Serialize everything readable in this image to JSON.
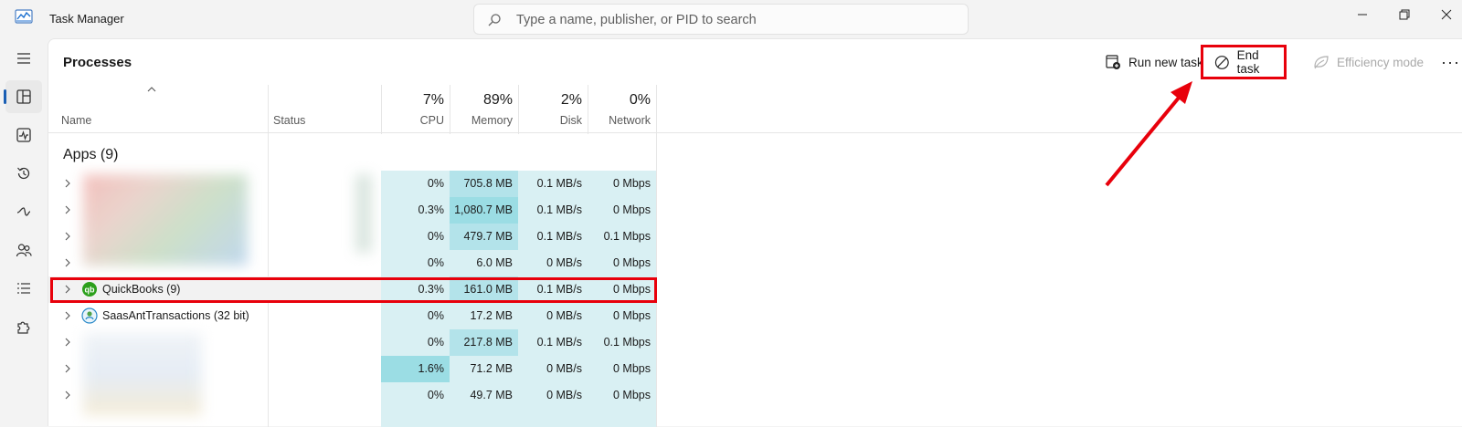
{
  "window": {
    "title": "Task Manager"
  },
  "search": {
    "placeholder": "Type a name, publisher, or PID to search"
  },
  "sidebar": {
    "items": [
      "menu",
      "processes",
      "performance",
      "app-history",
      "startup-apps",
      "users",
      "details",
      "services"
    ],
    "active": "processes"
  },
  "page": {
    "title": "Processes"
  },
  "toolbar": {
    "run_new_task": "Run new task",
    "end_task": "End task",
    "efficiency_mode": "Efficiency mode",
    "more": "···"
  },
  "columns": {
    "name": "Name",
    "status": "Status",
    "cpu": {
      "pct": "7%",
      "label": "CPU"
    },
    "memory": {
      "pct": "89%",
      "label": "Memory"
    },
    "disk": {
      "pct": "2%",
      "label": "Disk"
    },
    "network": {
      "pct": "0%",
      "label": "Network"
    }
  },
  "group": {
    "label": "Apps (9)"
  },
  "rows": [
    {
      "name": "",
      "cpu": "0%",
      "memory": "705.8 MB",
      "disk": "0.1 MB/s",
      "network": "0 Mbps"
    },
    {
      "name": "",
      "cpu": "0.3%",
      "memory": "1,080.7 MB",
      "disk": "0.1 MB/s",
      "network": "0 Mbps"
    },
    {
      "name": "",
      "cpu": "0%",
      "memory": "479.7 MB",
      "disk": "0.1 MB/s",
      "network": "0.1 Mbps"
    },
    {
      "name": "",
      "cpu": "0%",
      "memory": "6.0 MB",
      "disk": "0 MB/s",
      "network": "0 Mbps"
    },
    {
      "name": "QuickBooks (9)",
      "cpu": "0.3%",
      "memory": "161.0 MB",
      "disk": "0.1 MB/s",
      "network": "0 Mbps"
    },
    {
      "name": "SaasAntTransactions (32 bit)",
      "cpu": "0%",
      "memory": "17.2 MB",
      "disk": "0 MB/s",
      "network": "0 Mbps"
    },
    {
      "name": "",
      "cpu": "0%",
      "memory": "217.8 MB",
      "disk": "0.1 MB/s",
      "network": "0.1 Mbps"
    },
    {
      "name": "",
      "cpu": "1.6%",
      "memory": "71.2 MB",
      "disk": "0 MB/s",
      "network": "0 Mbps"
    },
    {
      "name": "",
      "cpu": "0%",
      "memory": "49.7 MB",
      "disk": "0 MB/s",
      "network": "0 Mbps"
    }
  ],
  "colors": {
    "highlight": "#e8000b",
    "heat_light": "#d9f0f3",
    "heat_mid": "#b3e3ea",
    "heat_high": "#9bdde4",
    "quickbooks": "#2ca01c"
  }
}
